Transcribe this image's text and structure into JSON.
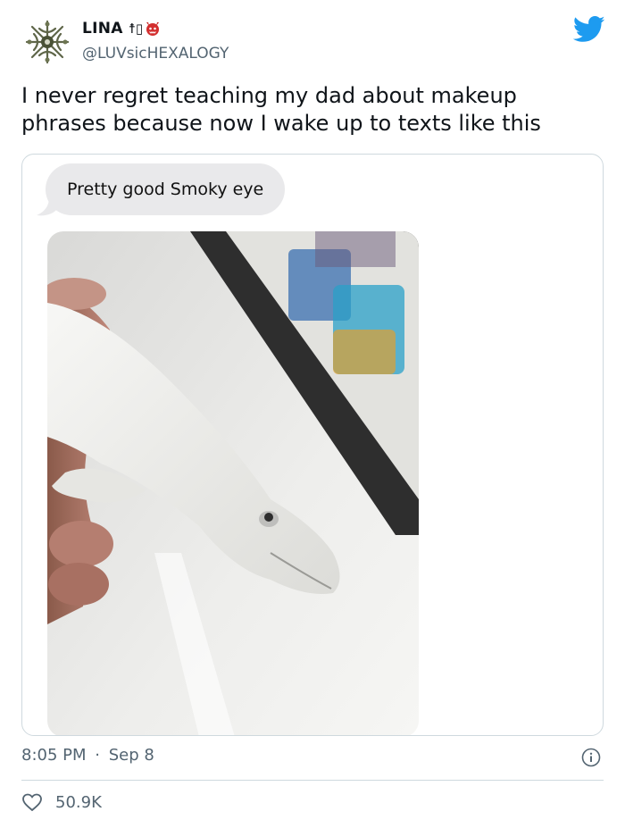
{
  "tweet": {
    "author": {
      "display_name": "LINA",
      "name_symbols": "☨▯",
      "handle": "@LUVsicHEXALOGY",
      "avatar_icon": "ornate-emblem-avatar",
      "extra_icon": "devil-face-icon"
    },
    "brand_icon": "twitter-bird-icon",
    "brand_color": "#1d9bf0",
    "text": "I never regret teaching my dad about makeup phrases because now I wake up to texts like this",
    "media": {
      "message_bubble_text": "Pretty good Smoky eye",
      "photo_icon": "beluga-toy-photo"
    },
    "time": "8:05 PM",
    "separator": "·",
    "date": "Sep 8",
    "likes": "50.9K",
    "colors": {
      "text": "#0f1419",
      "secondary": "#536471",
      "border": "#cfd9de",
      "bubble": "#e9e9eb"
    }
  }
}
